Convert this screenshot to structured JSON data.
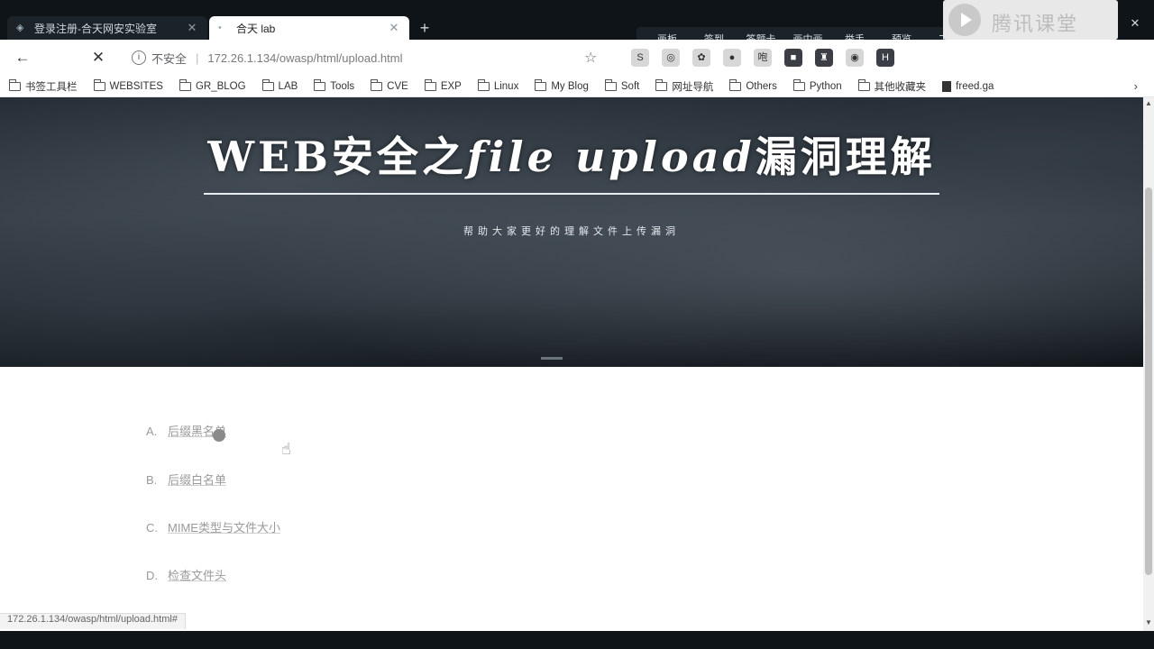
{
  "tabs": [
    {
      "title": "登录注册-合天网安实验室",
      "active": false
    },
    {
      "title": "合天 lab",
      "active": true
    }
  ],
  "window_controls": {
    "minimize": "—",
    "restore": "❐",
    "close": "✕"
  },
  "recorder_toolbar": {
    "items": [
      "画板",
      "签到",
      "答题卡",
      "画中画",
      "举手",
      "预览",
      "工具"
    ],
    "power": "⏻"
  },
  "address_bar": {
    "insecure_label": "不安全",
    "separator": "|",
    "url": "172.26.1.134/owasp/html/upload.html"
  },
  "nav": {
    "back": "←",
    "stop": "✕",
    "star": "☆"
  },
  "extensions": [
    "S",
    "◎",
    "✿",
    "●",
    "咆",
    "■",
    "♜",
    "◉",
    "H"
  ],
  "brand": {
    "text": "腾讯课堂"
  },
  "bookmarks": [
    {
      "label": "书签工具栏",
      "icon": "folder"
    },
    {
      "label": "WEBSITES",
      "icon": "folder"
    },
    {
      "label": "GR_BLOG",
      "icon": "folder"
    },
    {
      "label": "LAB",
      "icon": "folder"
    },
    {
      "label": "Tools",
      "icon": "folder"
    },
    {
      "label": "CVE",
      "icon": "folder"
    },
    {
      "label": "EXP",
      "icon": "folder"
    },
    {
      "label": "Linux",
      "icon": "folder"
    },
    {
      "label": "My Blog",
      "icon": "folder"
    },
    {
      "label": "Soft",
      "icon": "folder"
    },
    {
      "label": "网址导航",
      "icon": "folder"
    },
    {
      "label": "Others",
      "icon": "folder"
    },
    {
      "label": "Python",
      "icon": "folder"
    },
    {
      "label": "其他收藏夹",
      "icon": "folder"
    },
    {
      "label": "freed.ga",
      "icon": "page"
    }
  ],
  "hero": {
    "title_prefix": "WEB",
    "title_mid": "安全之",
    "title_cursive": "file upload",
    "title_suffix": "漏洞理解",
    "subtitle": "帮助大家更好的理解文件上传漏洞"
  },
  "options": [
    {
      "letter": "A.",
      "label": "后缀黑名单"
    },
    {
      "letter": "B.",
      "label": "后缀白名单"
    },
    {
      "letter": "C.",
      "label": "MIME类型与文件大小"
    },
    {
      "letter": "D.",
      "label": "检查文件头"
    }
  ],
  "status_bar": {
    "text": "172.26.1.134/owasp/html/upload.html#"
  },
  "scrollbar": {
    "up": "▲",
    "down": "▼"
  }
}
